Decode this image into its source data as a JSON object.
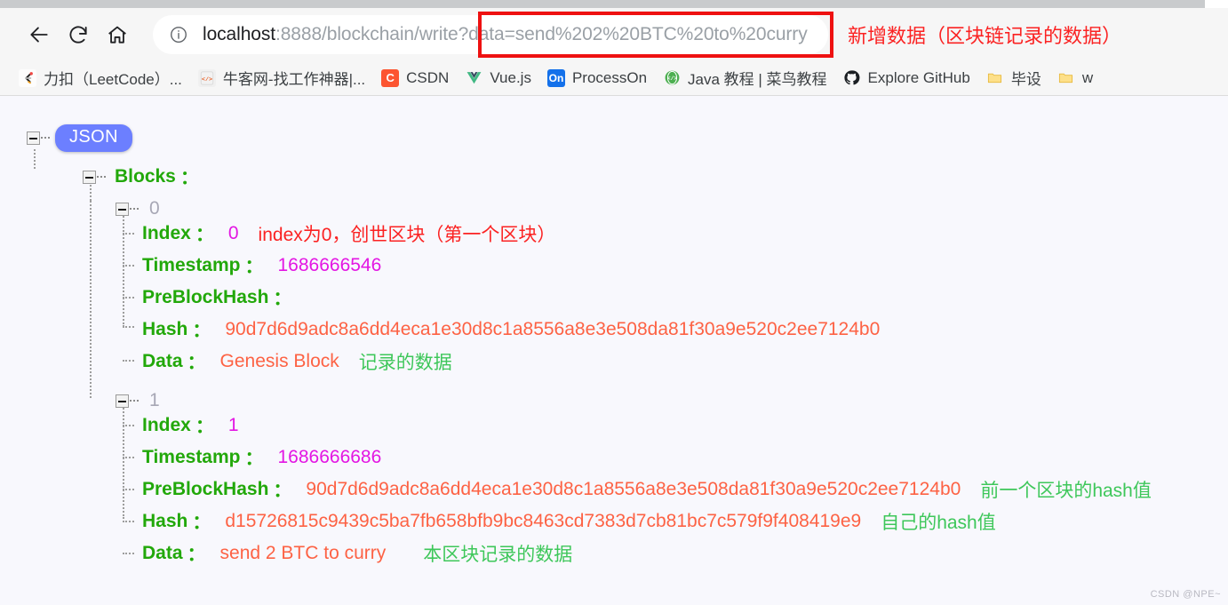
{
  "browser": {
    "nav": {
      "back_icon": "arrow-left-icon",
      "reload_icon": "reload-icon",
      "home_icon": "home-icon"
    },
    "omnibox": {
      "info_icon": "info-circle-icon",
      "url_host": "localhost",
      "url_rest": ":8888/blockchain/write?data=send%202%20BTC%20to%20curry",
      "url_full": "localhost:8888/blockchain/write?data=send%202%20BTC%20to%20curry",
      "highlight_color": "#ee1111"
    },
    "annotation": "新增数据（区块链记录的数据）",
    "bookmarks": [
      {
        "label": "力扣（LeetCode）...",
        "icon": "leetcode-icon",
        "glyph": "C"
      },
      {
        "label": "牛客网-找工作神器|...",
        "icon": "nowcoder-icon",
        "glyph": "</>"
      },
      {
        "label": "CSDN",
        "icon": "csdn-icon",
        "glyph": "C"
      },
      {
        "label": "Vue.js",
        "icon": "vue-icon",
        "glyph": "V"
      },
      {
        "label": "ProcessOn",
        "icon": "processon-icon",
        "glyph": "On"
      },
      {
        "label": "Java 教程 | 菜鸟教程",
        "icon": "runoob-icon",
        "glyph": "</>"
      },
      {
        "label": "Explore GitHub",
        "icon": "github-icon",
        "glyph": ""
      },
      {
        "label": "毕设",
        "icon": "folder-icon",
        "glyph": ""
      },
      {
        "label": "w",
        "icon": "folder-icon",
        "glyph": ""
      }
    ]
  },
  "viewer": {
    "root_badge": "JSON",
    "blocks_key": "Blocks",
    "colon": "：",
    "keys": {
      "index": "Index",
      "timestamp": "Timestamp",
      "preblockhash": "PreBlockHash",
      "hash": "Hash",
      "data": "Data"
    },
    "blocks": [
      {
        "node_label": "0",
        "index": "0",
        "index_note": "index为0，创世区块（第一个区块）",
        "timestamp": "1686666546",
        "preblockhash": "",
        "preblockhash_note": "",
        "hash": "90d7d6d9adc8a6dd4eca1e30d8c1a8556a8e3e508da81f30a9e520c2ee7124b0",
        "hash_note": "",
        "data": "Genesis Block",
        "data_note": "记录的数据"
      },
      {
        "node_label": "1",
        "index": "1",
        "index_note": "",
        "timestamp": "1686666686",
        "preblockhash": "90d7d6d9adc8a6dd4eca1e30d8c1a8556a8e3e508da81f30a9e520c2ee7124b0",
        "preblockhash_note": "前一个区块的hash值",
        "hash": "d15726815c9439c5ba7fb658bfb9bc8463cd7383d7cb81bc7c579f9f408419e9",
        "hash_note": "自己的hash值",
        "data": "send 2 BTC to curry",
        "data_note": "本区块记录的数据"
      }
    ],
    "colors": {
      "key": "#22a80a",
      "number": "#e316e3",
      "string": "#fd6244",
      "note_red": "#fb2222",
      "note_green": "#3ec75a",
      "badge": "#6c7fff",
      "background": "#f8f8fd"
    }
  },
  "watermark": "CSDN @NPE~"
}
